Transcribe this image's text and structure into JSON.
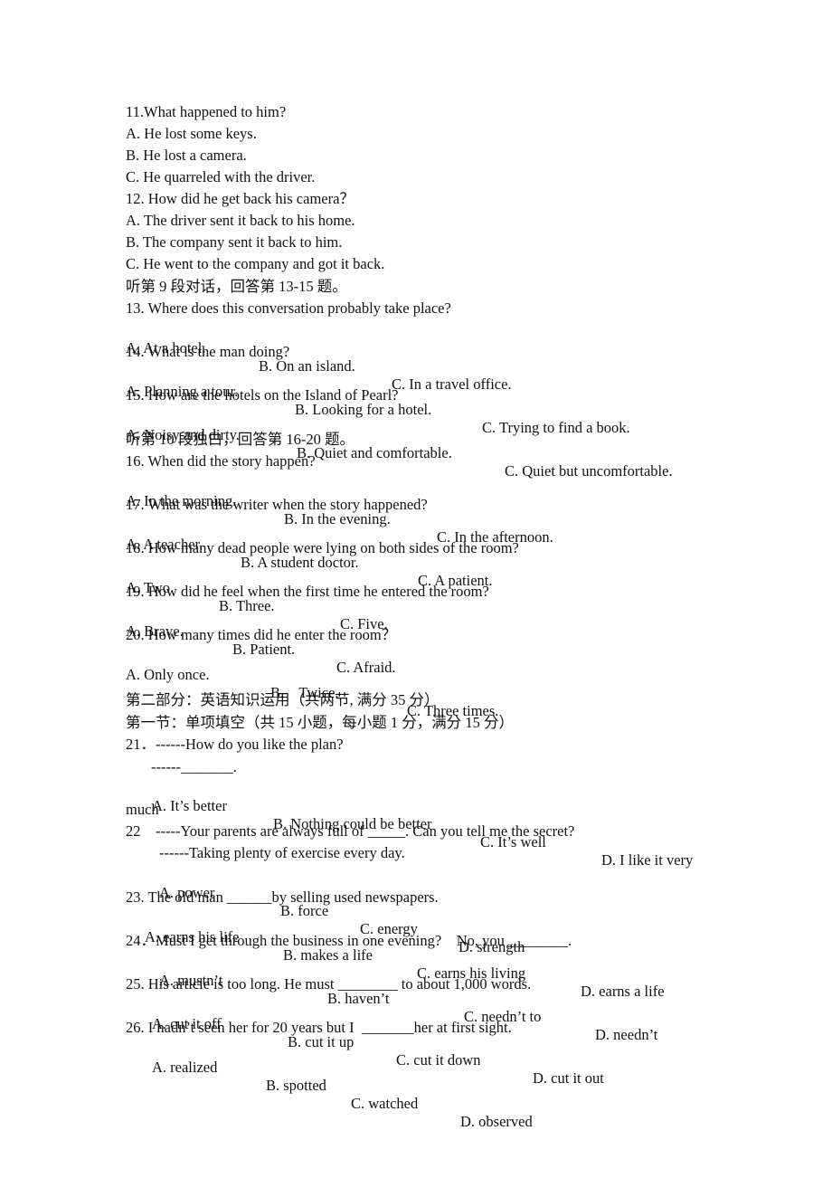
{
  "questions_part1": {
    "q11": {
      "stem": "11.What happened to him?",
      "a": "A. He lost some keys.",
      "b": "B. He lost a camera.",
      "c": "C. He quarreled with the driver."
    },
    "q12": {
      "stem": "12. How did he get back his camera？",
      "a": "A. The driver sent it back to his home.",
      "b": "B. The company sent it back to him.",
      "c": "C. He went to the company and got it back."
    },
    "section9": "听第 9 段对话，回答第 13-15 题。",
    "q13": {
      "stem": "13. Where does this conversation probably take place?",
      "a": "A. At a hotel.",
      "b": "B. On an island.",
      "c": "C. In a travel office."
    },
    "q14": {
      "stem": "14. What is the man doing?",
      "a": "A. Planning a tour.",
      "b": "B. Looking for a hotel.",
      "c": "C. Trying to find a book."
    },
    "q15": {
      "stem": "15. How are the hotels on the Island of Pearl?",
      "a": "A. Noisy and dirty.",
      "b": "B. Quiet and comfortable.",
      "c": "C. Quiet but uncomfortable."
    },
    "section10": "听第 10 段独白，回答第 16-20 题。",
    "q16": {
      "stem": "16. When did the story happen?",
      "a": "A. In the morning.",
      "b": "B. In the evening.",
      "c": "C. In the afternoon."
    },
    "q17": {
      "stem": "17. What was the writer when the story happened?",
      "a": "A. A teacher.",
      "b": "B. A student doctor.",
      "c": "C. A patient."
    },
    "q18": {
      "stem": "18. How many dead people were lying on both sides of the room?",
      "a": "A. Two",
      "b": "B. Three.",
      "c": "C. Five."
    },
    "q19": {
      "stem": "19. How did he feel when the first time he entered the room?",
      "a": "A. Brave.",
      "b": "B. Patient.",
      "c": "C. Afraid."
    },
    "q20": {
      "stem": "20. How many times did he enter the room？",
      "a": "A. Only once.",
      "b": "B.    Twice.",
      "c": "C. Three times."
    }
  },
  "part2": {
    "heading": "第二部分：英语知识运用（共两节, 满分 35 分）",
    "subheading": "第一节：单项填空（共 15 小题，每小题 1 分，满分 15 分）",
    "q21": {
      "stem": "21．------How do you like the plan?",
      "reply": "------_______.",
      "a": "A. It’s better",
      "b": "B. Nothing could be better",
      "c": "C. It’s well",
      "d": "D. I like it very",
      "d_cont": "much"
    },
    "q22": {
      "stem": "22    -----Your parents are always full of _____. Can you tell me the secret?",
      "reply": "------Taking plenty of exercise every day.",
      "a": "A. power",
      "b": "B. force",
      "c": "C. energy",
      "d": "D. strength"
    },
    "q23": {
      "stem": "23. The old man ______by selling used newspapers.",
      "a": "A. earns his life",
      "b": "B. makes a life",
      "c": "C. earns his living",
      "d": "D. earns a life"
    },
    "q24": {
      "stem": "24．Must I get through the business in one evening?    No, you ________.",
      "a": "A. mustn’t",
      "b": "B. haven’t",
      "c": "C. needn’t to",
      "d": "D. needn’t"
    },
    "q25": {
      "stem": "25. His article is too long. He must ________ to about 1,000 words.",
      "a": "A. cut it off",
      "b": "B. cut it up",
      "c": "C. cut it down",
      "d": "D. cut it out"
    },
    "q26": {
      "stem": "26. I hadn’t seen her for 20 years but I  _______her at first sight.",
      "a": "A. realized",
      "b": "B. spotted",
      "c": "C. watched",
      "d": "D. observed"
    }
  }
}
